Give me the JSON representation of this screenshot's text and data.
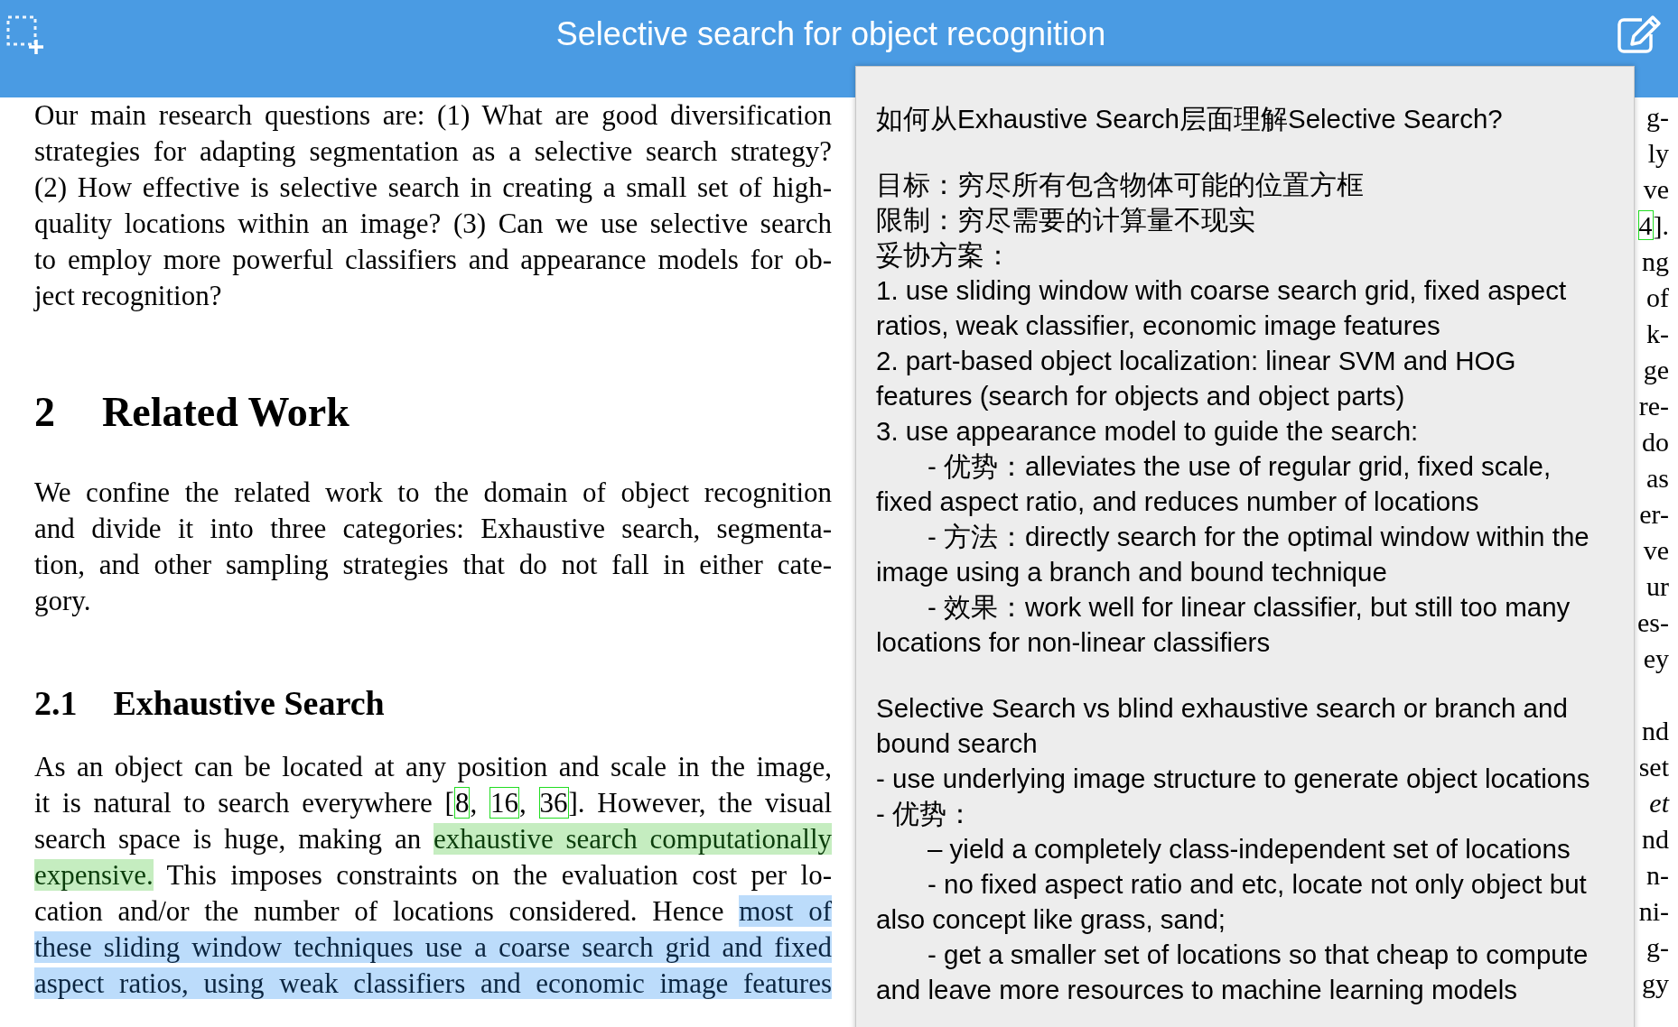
{
  "toolbar": {
    "title": "Selective search for object recognition"
  },
  "document": {
    "blocks": [
      {
        "kind": "paragraph",
        "continues": false,
        "lines": [
          [
            {
              "kind": "plain",
              "text": "Our main research questions are: (1) What are good diversification"
            }
          ],
          [
            {
              "kind": "plain",
              "text": "strategies for adapting segmentation as a selective search strategy?"
            }
          ],
          [
            {
              "kind": "plain",
              "text": "(2) How effective is selective search in creating a small set of high-"
            }
          ],
          [
            {
              "kind": "plain",
              "text": "quality locations within an image? (3) Can we use selective search"
            }
          ],
          [
            {
              "kind": "plain",
              "text": "to employ more powerful classifiers and appearance models for ob-"
            }
          ],
          [
            {
              "kind": "plain",
              "text": "ject recognition?"
            }
          ]
        ]
      },
      {
        "kind": "section",
        "number": "2",
        "title": "Related Work"
      },
      {
        "kind": "paragraph",
        "lines": [
          [
            {
              "kind": "plain",
              "text": "We confine the related work to the domain of object recognition"
            }
          ],
          [
            {
              "kind": "plain",
              "text": "and divide it into three categories: Exhaustive search, segmenta-"
            }
          ],
          [
            {
              "kind": "plain",
              "text": "tion, and other sampling strategies that do not fall in either cate-"
            }
          ],
          [
            {
              "kind": "plain",
              "text": "gory."
            }
          ]
        ]
      },
      {
        "kind": "subsection",
        "number": "2.1",
        "title": "Exhaustive Search"
      },
      {
        "kind": "paragraph",
        "continues": true,
        "lines": [
          [
            {
              "kind": "plain",
              "text": "As an object can be located at any position and scale in the image,"
            }
          ],
          [
            {
              "kind": "plain",
              "text": "it is natural to search everywhere ["
            },
            {
              "kind": "citation",
              "text": "8"
            },
            {
              "kind": "plain",
              "text": ", "
            },
            {
              "kind": "citation",
              "text": "16"
            },
            {
              "kind": "plain",
              "text": ", "
            },
            {
              "kind": "citation",
              "text": "36"
            },
            {
              "kind": "plain",
              "text": "]. However, the visual"
            }
          ],
          [
            {
              "kind": "plain",
              "text": "search space is huge, making an "
            },
            {
              "kind": "green-highlight",
              "text": "exhaustive search computationally"
            }
          ],
          [
            {
              "kind": "green-highlight",
              "text": "expensive."
            },
            {
              "kind": "plain",
              "text": " This imposes constraints on the evaluation cost per lo-"
            }
          ],
          [
            {
              "kind": "plain",
              "text": "cation and/or the number of locations considered. Hence "
            },
            {
              "kind": "blue-highlight",
              "text": "most of"
            }
          ],
          [
            {
              "kind": "blue-highlight",
              "text": "these sliding window techniques use a coarse search grid and fixed"
            }
          ],
          [
            {
              "kind": "blue-highlight",
              "text": "aspect ratios, using weak classifiers and economic image features"
            }
          ]
        ]
      }
    ],
    "right_column_groups": [
      [
        [
          {
            "kind": "plain",
            "text": "g-"
          }
        ],
        [
          {
            "kind": "plain",
            "text": "ly"
          }
        ],
        [
          {
            "kind": "plain",
            "text": "ve"
          }
        ],
        [
          {
            "kind": "citation",
            "text": "4"
          },
          {
            "kind": "plain",
            "text": "]."
          }
        ],
        [
          {
            "kind": "plain",
            "text": "ng"
          }
        ],
        [
          {
            "kind": "plain",
            "text": "of"
          }
        ],
        [
          {
            "kind": "plain",
            "text": "k-"
          }
        ],
        [
          {
            "kind": "plain",
            "text": "ge"
          }
        ],
        [
          {
            "kind": "plain",
            "text": "re-"
          }
        ],
        [
          {
            "kind": "plain",
            "text": "do"
          }
        ],
        [
          {
            "kind": "plain",
            "text": "as"
          }
        ],
        [
          {
            "kind": "plain",
            "text": "er-"
          }
        ],
        [
          {
            "kind": "plain",
            "text": "ve"
          }
        ],
        [
          {
            "kind": "plain",
            "text": "ur"
          }
        ],
        [
          {
            "kind": "plain",
            "text": "es-"
          }
        ],
        [
          {
            "kind": "plain",
            "text": "ey"
          }
        ]
      ],
      [
        [
          {
            "kind": "plain",
            "text": "nd"
          }
        ],
        [
          {
            "kind": "plain",
            "text": "set"
          }
        ],
        [
          {
            "kind": "italic",
            "text": "et"
          }
        ],
        [
          {
            "kind": "plain",
            "text": "nd"
          }
        ],
        [
          {
            "kind": "plain",
            "text": "n-"
          }
        ],
        [
          {
            "kind": "plain",
            "text": "ni-"
          }
        ],
        [
          {
            "kind": "plain",
            "text": "g-"
          }
        ],
        [
          {
            "kind": "plain",
            "text": "gy"
          }
        ]
      ]
    ]
  },
  "note_popup": {
    "sections": [
      [
        {
          "kind": "text",
          "text": "如何从Exhaustive Search层面理解Selective Search?"
        }
      ],
      [
        {
          "kind": "text",
          "text": "目标：穷尽所有包含物体可能的位置方框"
        },
        {
          "kind": "text",
          "text": "限制：穷尽需要的计算量不现实"
        },
        {
          "kind": "text",
          "text": "妥协方案："
        },
        {
          "kind": "text",
          "text": "1. use sliding window with coarse search grid, fixed aspect ratios, weak classifier, economic image features"
        },
        {
          "kind": "text",
          "text": "2. part-based object localization: linear SVM and HOG features (search for objects and object parts)"
        },
        {
          "kind": "text",
          "text": "3. use appearance model to guide the search:"
        },
        {
          "kind": "indented",
          "text": "- 优势：alleviates the use of regular grid, fixed scale, fixed aspect ratio, and reduces number of locations"
        },
        {
          "kind": "indented",
          "text": "- 方法：directly search for the optimal window within the image using a branch and bound technique"
        },
        {
          "kind": "indented",
          "text": "- 效果：work well for linear classifier, but still too many locations for non-linear classifiers"
        }
      ],
      [
        {
          "kind": "text",
          "text": "Selective Search vs blind exhaustive search or branch and bound search"
        },
        {
          "kind": "text",
          "text": "- use underlying image structure to generate object locations"
        },
        {
          "kind": "text",
          "text": "- 优势："
        },
        {
          "kind": "indented",
          "text": "– yield a completely class-independent set of locations"
        },
        {
          "kind": "indented",
          "text": "- no fixed aspect ratio and etc, locate not only object but also concept like grass, sand;"
        },
        {
          "kind": "indented",
          "text": "- get a smaller set of locations so that cheap to compute and leave more resources to machine learning models"
        }
      ]
    ]
  }
}
